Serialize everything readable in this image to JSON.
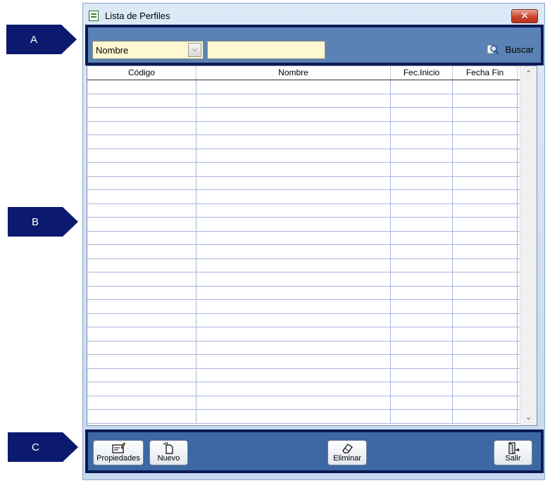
{
  "callouts": {
    "a": "A",
    "b": "B",
    "c": "C"
  },
  "window": {
    "title": "Lista de Perfiles",
    "close_label": "✕"
  },
  "toolbar": {
    "field_select_value": "Nombre",
    "search_value": "",
    "search_label": "Buscar"
  },
  "grid": {
    "columns": [
      "Código",
      "Nombre",
      "Fec.Inicio",
      "Fecha Fin"
    ],
    "empty_rows": 25
  },
  "buttons": {
    "propiedades": "Propiedades",
    "nuevo": "Nuevo",
    "eliminar": "Eliminar",
    "salir": "Salir"
  },
  "icons": {
    "app": "list-window-icon",
    "dropdown": "chevron-down-icon",
    "search": "search-icon",
    "propiedades": "properties-icon",
    "nuevo": "new-document-icon",
    "eliminar": "eraser-icon",
    "salir": "exit-door-icon"
  },
  "colors": {
    "callout": "#0b1a6e",
    "toolbar": "#5b82b5",
    "bottombar": "#3e68a3",
    "input_bg": "#fdf8cf",
    "grid_line": "#a9b4e0"
  }
}
